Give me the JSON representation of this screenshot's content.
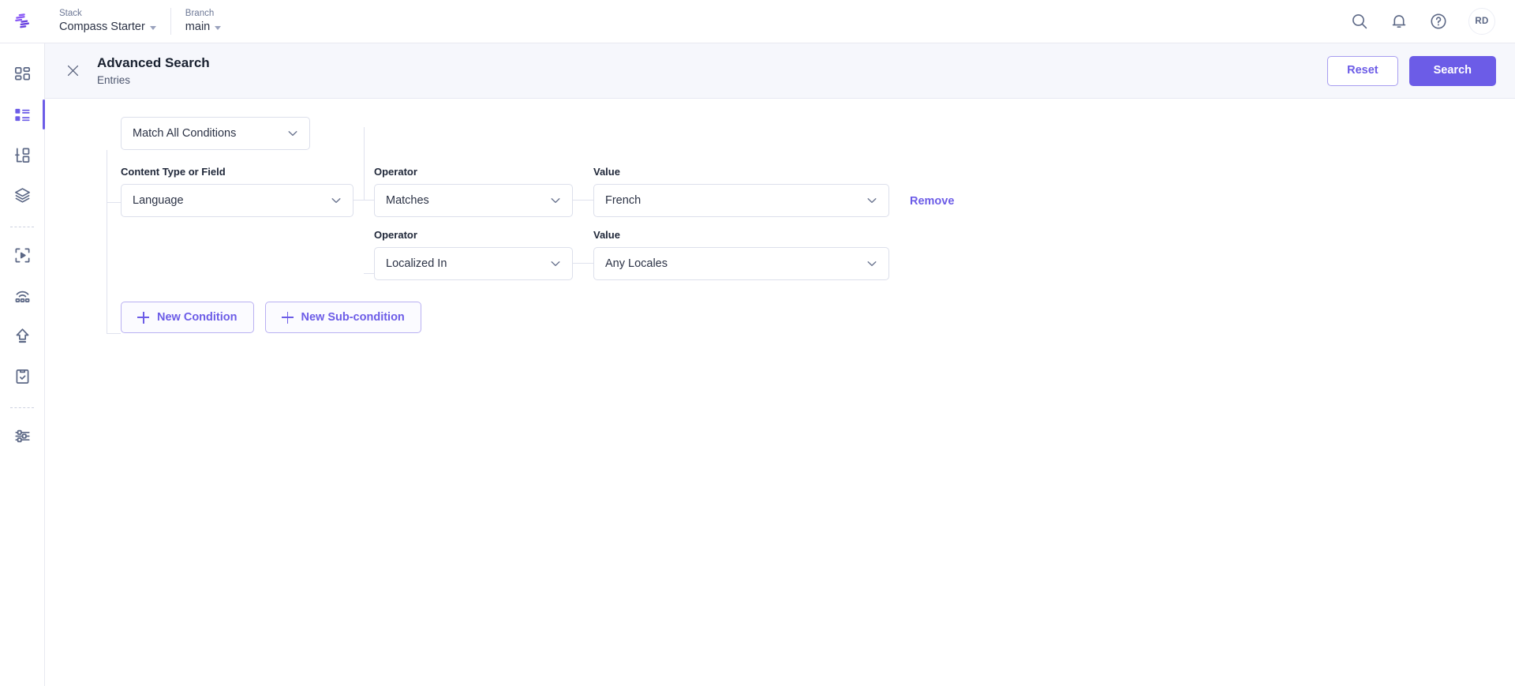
{
  "topbar": {
    "logo_name": "contentstack-logo",
    "breadcrumbs": [
      {
        "label": "Stack",
        "value": "Compass Starter"
      },
      {
        "label": "Branch",
        "value": "main"
      }
    ],
    "icons": [
      "search-icon",
      "bell-icon",
      "help-icon"
    ],
    "avatar_initials": "RD"
  },
  "sidebar": {
    "items": [
      {
        "name": "dashboard",
        "icon": "dashboard-grid-icon",
        "active": false
      },
      {
        "name": "entries",
        "icon": "entries-list-icon",
        "active": true
      },
      {
        "name": "content-types",
        "icon": "content-model-icon",
        "active": false
      },
      {
        "name": "assets",
        "icon": "layers-stack-icon",
        "active": false
      },
      {
        "name": "live-preview",
        "icon": "live-preview-icon",
        "active": false
      },
      {
        "name": "releases",
        "icon": "releases-icon",
        "active": false
      },
      {
        "name": "publish-queue",
        "icon": "publish-upload-icon",
        "active": false
      },
      {
        "name": "audit-log",
        "icon": "clipboard-check-icon",
        "active": false
      },
      {
        "name": "settings",
        "icon": "sliders-settings-icon",
        "active": false
      }
    ]
  },
  "panel": {
    "close_icon": "close-icon",
    "title": "Advanced Search",
    "subtitle": "Entries",
    "reset_label": "Reset",
    "search_label": "Search"
  },
  "builder": {
    "match_mode": "Match All Conditions",
    "labels": {
      "content_type_or_field": "Content Type or Field",
      "operator": "Operator",
      "value": "Value"
    },
    "conditions": [
      {
        "content_type_or_field": "Language",
        "operator": "Matches",
        "value": "French",
        "remove_label": "Remove"
      },
      {
        "operator": "Localized In",
        "value": "Any Locales"
      }
    ],
    "new_condition_label": "New Condition",
    "new_subcondition_label": "New Sub-condition"
  },
  "colors": {
    "accent": "#6c5ce7",
    "header_bg": "#f6f7fc",
    "text": "#2b3245",
    "border": "#dcdfeb"
  }
}
